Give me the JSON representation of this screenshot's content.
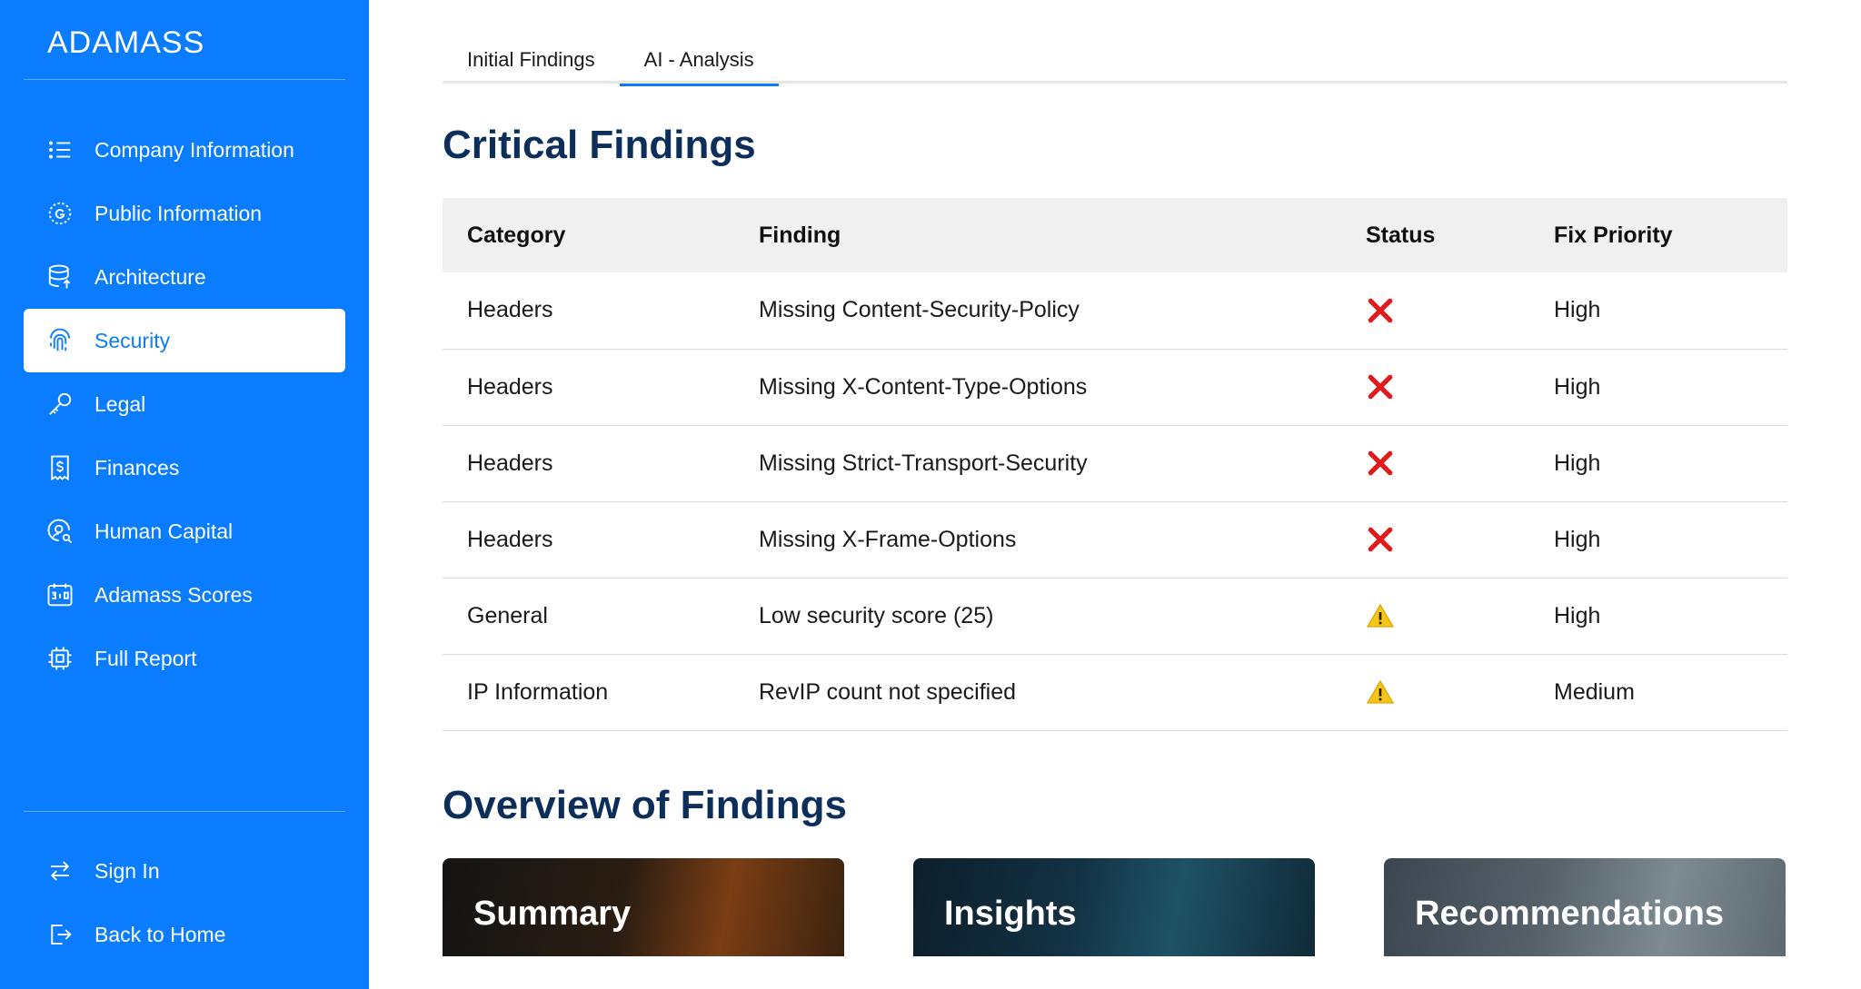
{
  "sidebar": {
    "logo": "ADAMASS",
    "items": [
      {
        "label": "Company Information",
        "icon": "list-icon"
      },
      {
        "label": "Public Information",
        "icon": "google-icon"
      },
      {
        "label": "Architecture",
        "icon": "database-icon"
      },
      {
        "label": "Security",
        "icon": "fingerprint-icon",
        "active": true
      },
      {
        "label": "Legal",
        "icon": "key-icon"
      },
      {
        "label": "Finances",
        "icon": "receipt-dollar-icon"
      },
      {
        "label": "Human Capital",
        "icon": "user-search-icon"
      },
      {
        "label": "Adamass Scores",
        "icon": "scoreboard-icon"
      },
      {
        "label": "Full Report",
        "icon": "chip-icon"
      }
    ],
    "bottom_items": [
      {
        "label": "Sign In",
        "icon": "arrows-swap-icon"
      },
      {
        "label": "Back to Home",
        "icon": "logout-icon"
      }
    ]
  },
  "tabs": [
    {
      "label": "Initial Findings",
      "active": false
    },
    {
      "label": "AI - Analysis",
      "active": true
    }
  ],
  "critical": {
    "heading": "Critical Findings",
    "columns": [
      "Category",
      "Finding",
      "Status",
      "Fix Priority"
    ],
    "rows": [
      {
        "category": "Headers",
        "finding": "Missing Content-Security-Policy",
        "status": "fail-icon",
        "priority": "High"
      },
      {
        "category": "Headers",
        "finding": "Missing X-Content-Type-Options",
        "status": "fail-icon",
        "priority": "High"
      },
      {
        "category": "Headers",
        "finding": "Missing Strict-Transport-Security",
        "status": "fail-icon",
        "priority": "High"
      },
      {
        "category": "Headers",
        "finding": "Missing X-Frame-Options",
        "status": "fail-icon",
        "priority": "High"
      },
      {
        "category": "General",
        "finding": "Low security score (25)",
        "status": "warning-icon",
        "priority": "High"
      },
      {
        "category": "IP Information",
        "finding": "RevIP count not specified",
        "status": "warning-icon",
        "priority": "Medium"
      }
    ]
  },
  "overview": {
    "heading": "Overview of Findings",
    "cards": [
      {
        "title": "Summary"
      },
      {
        "title": "Insights"
      },
      {
        "title": "Recommendations"
      }
    ]
  },
  "colors": {
    "sidebar_bg": "#0a7cff",
    "heading": "#0b2e5b",
    "fail": "#e01b1b",
    "warning": "#f5c518"
  }
}
